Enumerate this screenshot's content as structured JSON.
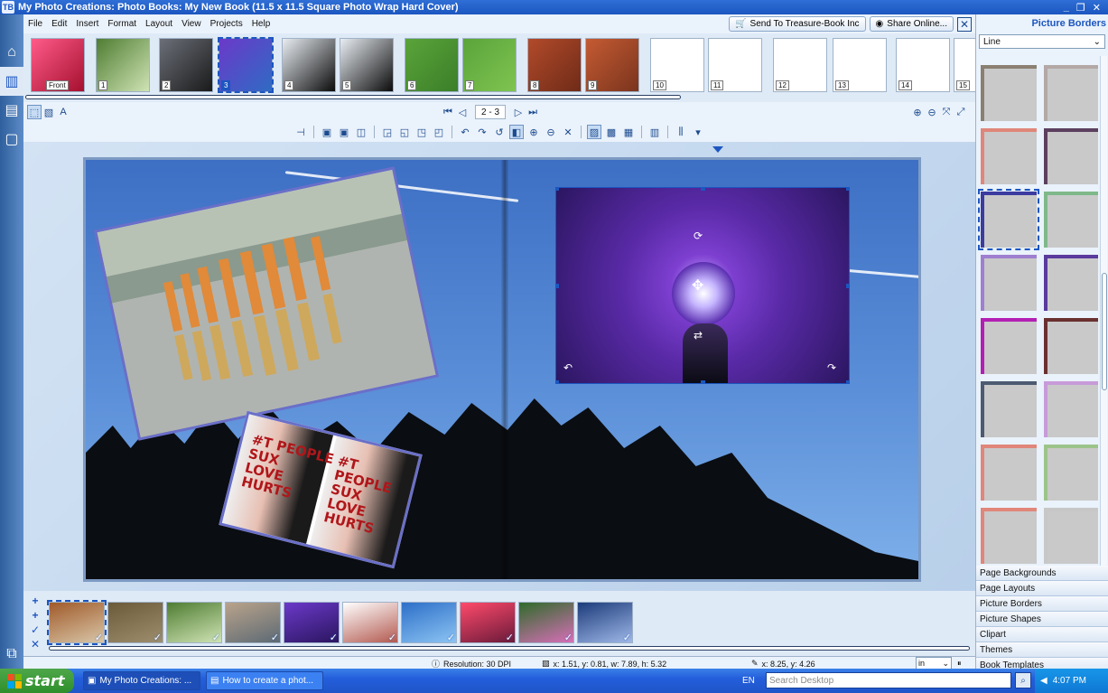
{
  "window": {
    "title": "My Photo Creations: Photo Books: My New Book (11.5 x 11.5 Square Photo Wrap Hard Cover)",
    "app_icon": "TB"
  },
  "menu": [
    "File",
    "Edit",
    "Insert",
    "Format",
    "Layout",
    "View",
    "Projects",
    "Help"
  ],
  "actions": {
    "send": "Send To Treasure-Book Inc",
    "share": "Share Online..."
  },
  "pages": [
    {
      "label": "Front",
      "colors": [
        "#ff5b8a",
        "#a5102e"
      ]
    },
    {
      "label": "1",
      "colors": [
        "#4f7d32",
        "#cfe3b4"
      ]
    },
    {
      "label": "2",
      "colors": [
        "#6b6f78",
        "#1a1a1a"
      ]
    },
    {
      "label": "3",
      "colors": [
        "#6b39c9",
        "#2f6bc4"
      ]
    },
    {
      "label": "4",
      "colors": [
        "#e9eef3",
        "#0b0b0b"
      ]
    },
    {
      "label": "5",
      "colors": [
        "#e9eef3",
        "#0b0b0b"
      ]
    },
    {
      "label": "6",
      "colors": [
        "#5aa43a",
        "#3b7e28"
      ]
    },
    {
      "label": "7",
      "colors": [
        "#5aa43a",
        "#7fc451"
      ]
    },
    {
      "label": "8",
      "colors": [
        "#b24a2a",
        "#6f2b18"
      ]
    },
    {
      "label": "9",
      "colors": [
        "#c55b33",
        "#7a341d"
      ]
    },
    {
      "label": "10",
      "colors": [
        "#ffffff",
        "#ffffff"
      ]
    },
    {
      "label": "11",
      "colors": [
        "#ffffff",
        "#ffffff"
      ]
    },
    {
      "label": "12",
      "colors": [
        "#ffffff",
        "#ffffff"
      ]
    },
    {
      "label": "13",
      "colors": [
        "#ffffff",
        "#ffffff"
      ]
    },
    {
      "label": "14",
      "colors": [
        "#ffffff",
        "#ffffff"
      ]
    },
    {
      "label": "15",
      "colors": [
        "#ffffff",
        "#ffffff"
      ]
    }
  ],
  "selected_page": "3",
  "navigation": {
    "page_range": "2 - 3"
  },
  "photo_text": {
    "line1": "#T PEOPLE",
    "line2": "SUX",
    "line3": "LOVE",
    "line4": "HURTS"
  },
  "tray_images": [
    {
      "colors": [
        "#a05a2a",
        "#d8c6a8"
      ],
      "selected": true
    },
    {
      "colors": [
        "#6a5a3a",
        "#9e8e6e"
      ]
    },
    {
      "colors": [
        "#4f7d32",
        "#cfe3b4"
      ]
    },
    {
      "colors": [
        "#b9a38b",
        "#5d6a74"
      ]
    },
    {
      "colors": [
        "#6b39c9",
        "#2b1660"
      ]
    },
    {
      "colors": [
        "#ffffff",
        "#b35a50"
      ]
    },
    {
      "colors": [
        "#2d6fc8",
        "#8cc4f3"
      ]
    },
    {
      "colors": [
        "#ff4a6b",
        "#6a1a3a"
      ]
    },
    {
      "colors": [
        "#2f6b2a",
        "#d86fb8"
      ]
    },
    {
      "colors": [
        "#1c3b7a",
        "#9fb8e8"
      ]
    }
  ],
  "status": {
    "resolution": "Resolution: 30 DPI",
    "geometry": "x: 1.51, y: 0.81, w: 7.89, h: 5.32",
    "cursor": "x: 8.25, y: 4.26",
    "unit": "in"
  },
  "panel": {
    "title": "Picture Borders",
    "style": "Line",
    "border_colors": [
      "#8a7f72",
      "#b3a8a6",
      "#e0867a",
      "#5c3f5f",
      "#3c3ca0",
      "#7fb98a",
      "#9f7fcf",
      "#5a3a9c",
      "#b31fb3",
      "#6a3030",
      "#4c5a72",
      "#c79bd8",
      "#e0867a",
      "#9cc48a",
      "#e0867a",
      "#c7c7c7"
    ],
    "selected_border": 4,
    "sections": [
      "Page Backgrounds",
      "Page Layouts",
      "Picture Borders",
      "Picture Shapes",
      "Clipart",
      "Themes",
      "Book Templates"
    ]
  },
  "taskbar": {
    "start": "start",
    "tasks": [
      "My Photo Creations: ...",
      "How to create a phot..."
    ],
    "lang": "EN",
    "search_placeholder": "Search Desktop",
    "clock": "4:07 PM"
  }
}
